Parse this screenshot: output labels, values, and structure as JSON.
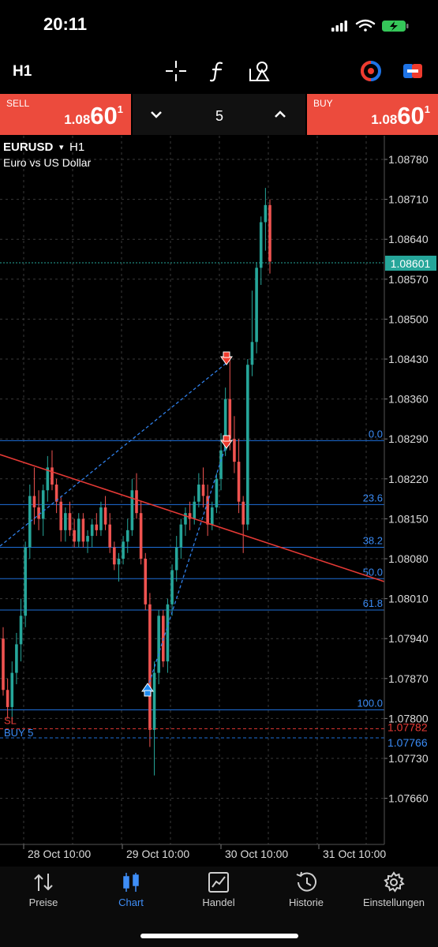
{
  "status_bar": {
    "time": "20:11"
  },
  "toolbar": {
    "timeframe": "H1",
    "icons": [
      "crosshair-icon",
      "function-icon",
      "objects-icon",
      "one-click-trading-icon",
      "trade-levels-icon"
    ]
  },
  "trade_bar": {
    "sell": {
      "label": "SELL",
      "price_prefix": "1.08",
      "price_big": "60",
      "price_sup": "1"
    },
    "volume": "5",
    "buy": {
      "label": "BUY",
      "price_prefix": "1.08",
      "price_big": "60",
      "price_sup": "1"
    }
  },
  "chart": {
    "symbol": "EURUSD",
    "symbol_arrow": "▾",
    "timeframe": "H1",
    "description": "Euro vs US Dollar",
    "current_price_label": "1.08601",
    "sl_label": "SL",
    "buy_label": "BUY 5",
    "sl_price_label": "1.07782",
    "buy_price_label": "1.07766",
    "fib_labels": [
      "0.0",
      "23.6",
      "38.2",
      "50.0",
      "61.8",
      "100.0"
    ],
    "colors": {
      "bull": "#26a69a",
      "bear": "#ef5350",
      "fib": "#1e6fd9",
      "trend": "#e53935",
      "bg": "#000000",
      "grid": "#3a3a3a"
    }
  },
  "chart_data": {
    "type": "candlestick",
    "symbol": "EURUSD",
    "timeframe": "H1",
    "y_ticks": [
      "1.08780",
      "1.08710",
      "1.08640",
      "1.08570",
      "1.08500",
      "1.08430",
      "1.08360",
      "1.08290",
      "1.08220",
      "1.08150",
      "1.08080",
      "1.08010",
      "1.07940",
      "1.07870",
      "1.07800",
      "1.07730",
      "1.07660"
    ],
    "x_ticks": [
      "28 Oct 10:00",
      "29 Oct 10:00",
      "30 Oct 10:00",
      "31 Oct 10:00"
    ],
    "ylim": [
      1.0762,
      1.0881
    ],
    "current_price": 1.08601,
    "fib_levels": [
      {
        "level": "0.0",
        "price": 1.08287
      },
      {
        "level": "23.6",
        "price": 1.08175
      },
      {
        "level": "38.2",
        "price": 1.081
      },
      {
        "level": "50.0",
        "price": 1.08045
      },
      {
        "level": "61.8",
        "price": 1.0799
      },
      {
        "level": "100.0",
        "price": 1.07815
      }
    ],
    "sl_price": 1.07782,
    "buy_price": 1.07766,
    "candles": [
      [
        1.0794,
        1.0796,
        1.0784,
        1.0785
      ],
      [
        1.0785,
        1.0787,
        1.078,
        1.0782
      ],
      [
        1.0782,
        1.079,
        1.0779,
        1.0788
      ],
      [
        1.0788,
        1.0795,
        1.0786,
        1.0793
      ],
      [
        1.0793,
        1.0801,
        1.079,
        1.0798
      ],
      [
        1.0798,
        1.0811,
        1.0796,
        1.081
      ],
      [
        1.081,
        1.0821,
        1.0808,
        1.0819
      ],
      [
        1.0819,
        1.0824,
        1.0814,
        1.0817
      ],
      [
        1.0817,
        1.082,
        1.0813,
        1.0815
      ],
      [
        1.0815,
        1.0821,
        1.0812,
        1.082
      ],
      [
        1.082,
        1.0826,
        1.0818,
        1.0824
      ],
      [
        1.0824,
        1.0827,
        1.082,
        1.0821
      ],
      [
        1.0821,
        1.0822,
        1.0816,
        1.0818
      ],
      [
        1.0818,
        1.0819,
        1.0811,
        1.0813
      ],
      [
        1.0813,
        1.0817,
        1.0811,
        1.0816
      ],
      [
        1.0816,
        1.0818,
        1.0812,
        1.0813
      ],
      [
        1.0813,
        1.0815,
        1.081,
        1.0811
      ],
      [
        1.0811,
        1.0816,
        1.081,
        1.0815
      ],
      [
        1.0815,
        1.0816,
        1.081,
        1.0811
      ],
      [
        1.0811,
        1.0813,
        1.0809,
        1.0812
      ],
      [
        1.0812,
        1.0815,
        1.081,
        1.0814
      ],
      [
        1.0814,
        1.0816,
        1.0812,
        1.0813
      ],
      [
        1.0813,
        1.0818,
        1.0812,
        1.0817
      ],
      [
        1.0817,
        1.0819,
        1.0813,
        1.0814
      ],
      [
        1.0814,
        1.0816,
        1.0809,
        1.081
      ],
      [
        1.081,
        1.0811,
        1.0806,
        1.0807
      ],
      [
        1.0807,
        1.0809,
        1.0804,
        1.0808
      ],
      [
        1.0808,
        1.0812,
        1.0807,
        1.0811
      ],
      [
        1.0811,
        1.0815,
        1.0809,
        1.0813
      ],
      [
        1.0813,
        1.0822,
        1.0812,
        1.082
      ],
      [
        1.082,
        1.0823,
        1.0815,
        1.0816
      ],
      [
        1.0816,
        1.0818,
        1.0807,
        1.0808
      ],
      [
        1.0808,
        1.0809,
        1.0799,
        1.08
      ],
      [
        1.08,
        1.0802,
        1.0775,
        1.0778
      ],
      [
        1.0778,
        1.079,
        1.077,
        1.0788
      ],
      [
        1.0788,
        1.0799,
        1.0786,
        1.0798
      ],
      [
        1.0798,
        1.0799,
        1.0789,
        1.079
      ],
      [
        1.079,
        1.0801,
        1.0788,
        1.08
      ],
      [
        1.08,
        1.0807,
        1.0798,
        1.0806
      ],
      [
        1.0806,
        1.0812,
        1.0804,
        1.081
      ],
      [
        1.081,
        1.0815,
        1.0808,
        1.0814
      ],
      [
        1.0814,
        1.0817,
        1.0812,
        1.0816
      ],
      [
        1.0816,
        1.0818,
        1.0813,
        1.0815
      ],
      [
        1.0815,
        1.0819,
        1.0814,
        1.0818
      ],
      [
        1.0818,
        1.0823,
        1.0817,
        1.0821
      ],
      [
        1.0821,
        1.0824,
        1.0817,
        1.0819
      ],
      [
        1.0819,
        1.0821,
        1.0812,
        1.0814
      ],
      [
        1.0814,
        1.0818,
        1.0813,
        1.0817
      ],
      [
        1.0817,
        1.0823,
        1.0816,
        1.0822
      ],
      [
        1.0822,
        1.083,
        1.082,
        1.0827
      ],
      [
        1.0827,
        1.0838,
        1.0826,
        1.0836
      ],
      [
        1.0836,
        1.0843,
        1.0827,
        1.0829
      ],
      [
        1.0829,
        1.0833,
        1.0823,
        1.0825
      ],
      [
        1.0825,
        1.0829,
        1.0816,
        1.0818
      ],
      [
        1.0818,
        1.0819,
        1.0809,
        1.0814
      ],
      [
        1.0814,
        1.0843,
        1.0813,
        1.0842
      ],
      [
        1.0842,
        1.0855,
        1.084,
        1.0846
      ],
      [
        1.0846,
        1.086,
        1.0844,
        1.0859
      ],
      [
        1.0859,
        1.0868,
        1.0856,
        1.0867
      ],
      [
        1.0867,
        1.0873,
        1.0862,
        1.087
      ],
      [
        1.087,
        1.0871,
        1.0858,
        1.08601
      ]
    ]
  },
  "nav": {
    "items": [
      {
        "label": "Preise",
        "icon": "quotes-icon"
      },
      {
        "label": "Chart",
        "icon": "chart-icon"
      },
      {
        "label": "Handel",
        "icon": "trade-icon"
      },
      {
        "label": "Historie",
        "icon": "history-icon"
      },
      {
        "label": "Einstellungen",
        "icon": "settings-icon"
      }
    ],
    "active": "Chart"
  }
}
